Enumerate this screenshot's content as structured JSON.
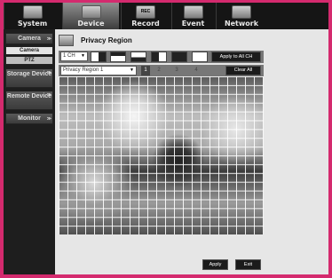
{
  "top_tabs": [
    {
      "label": "System",
      "icon": "monitor-icon"
    },
    {
      "label": "Device",
      "icon": "camera-icon"
    },
    {
      "label": "Record",
      "icon": "record-icon"
    },
    {
      "label": "Event",
      "icon": "event-icon"
    },
    {
      "label": "Network",
      "icon": "network-icon"
    }
  ],
  "record_icon_text": "REC",
  "sidebar": {
    "camera": "Camera",
    "camera_sub": "Camera",
    "ptz": "PTZ",
    "storage": "Storage Device",
    "remote": "Remote Device",
    "monitor": "Monitor"
  },
  "page": {
    "title": "Privacy Region"
  },
  "controls": {
    "channel": "1 CH",
    "apply_all": "Apply to All CH",
    "region": "Privacy Region 1",
    "numbers": [
      "1",
      "2",
      "3",
      "4"
    ],
    "clear_all": "Clear All"
  },
  "footer": {
    "apply": "Apply",
    "exit": "Exit"
  },
  "colors": {
    "accent": "#d42a6e",
    "dark": "#151515"
  }
}
